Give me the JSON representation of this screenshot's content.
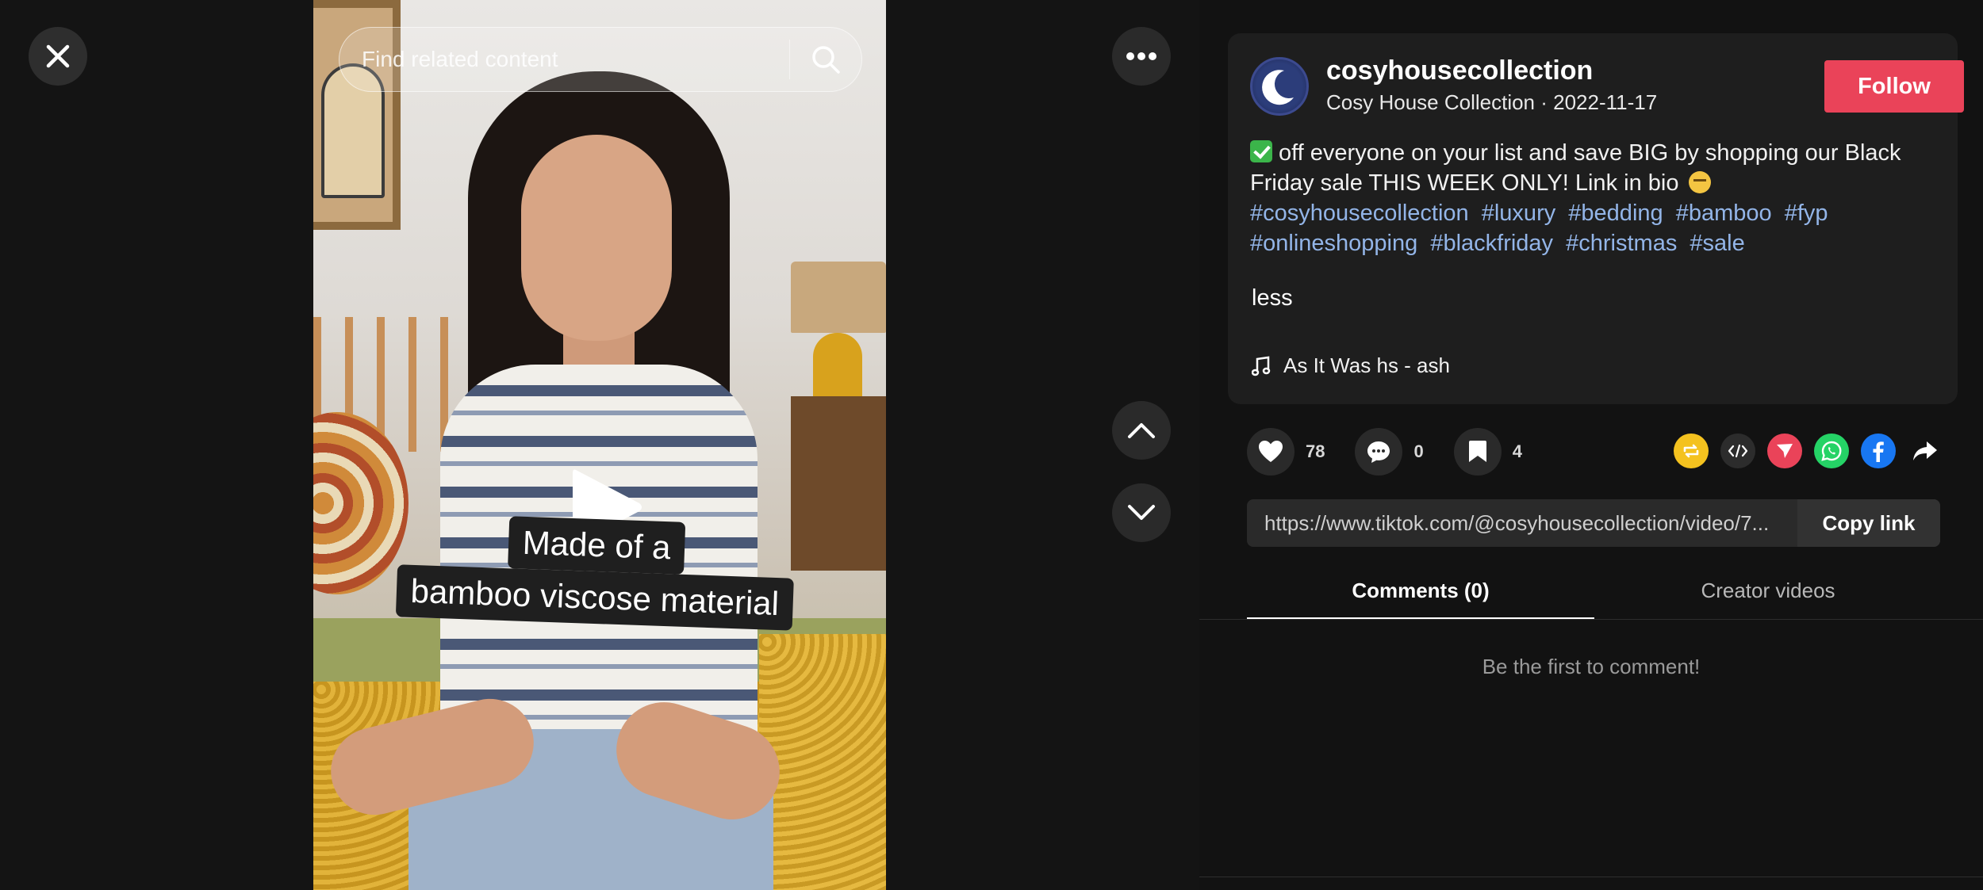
{
  "video": {
    "search_placeholder": "Find related content",
    "caption_line1": "Made of a",
    "caption_line2": "bamboo viscose material"
  },
  "post": {
    "username": "cosyhousecollection",
    "display_name": "Cosy House Collection",
    "date": "2022-11-17",
    "follow_label": "Follow",
    "description": "off everyone on your list and save BIG by shopping our Black Friday sale THIS WEEK ONLY! Link in bio",
    "hashtags": [
      "#cosyhousecollection",
      "#luxury",
      "#bedding",
      "#bamboo",
      "#fyp",
      "#onlineshopping",
      "#blackfriday",
      "#christmas",
      "#sale"
    ],
    "less_label": "less",
    "music": "As It Was hs - ash"
  },
  "actions": {
    "likes": "78",
    "comments": "0",
    "saves": "4"
  },
  "share": {
    "link": "https://www.tiktok.com/@cosyhousecollection/video/7...",
    "copy_label": "Copy link"
  },
  "tabs": {
    "comments": "Comments (0)",
    "creator_videos": "Creator videos"
  },
  "comments": {
    "empty_text": "Be the first to comment!"
  },
  "colors": {
    "follow": "#ea4359",
    "hashtag": "#93b5e8",
    "repost": "#f4c21f",
    "send": "#ea4359",
    "whatsapp": "#25d366",
    "facebook": "#1877f2"
  }
}
